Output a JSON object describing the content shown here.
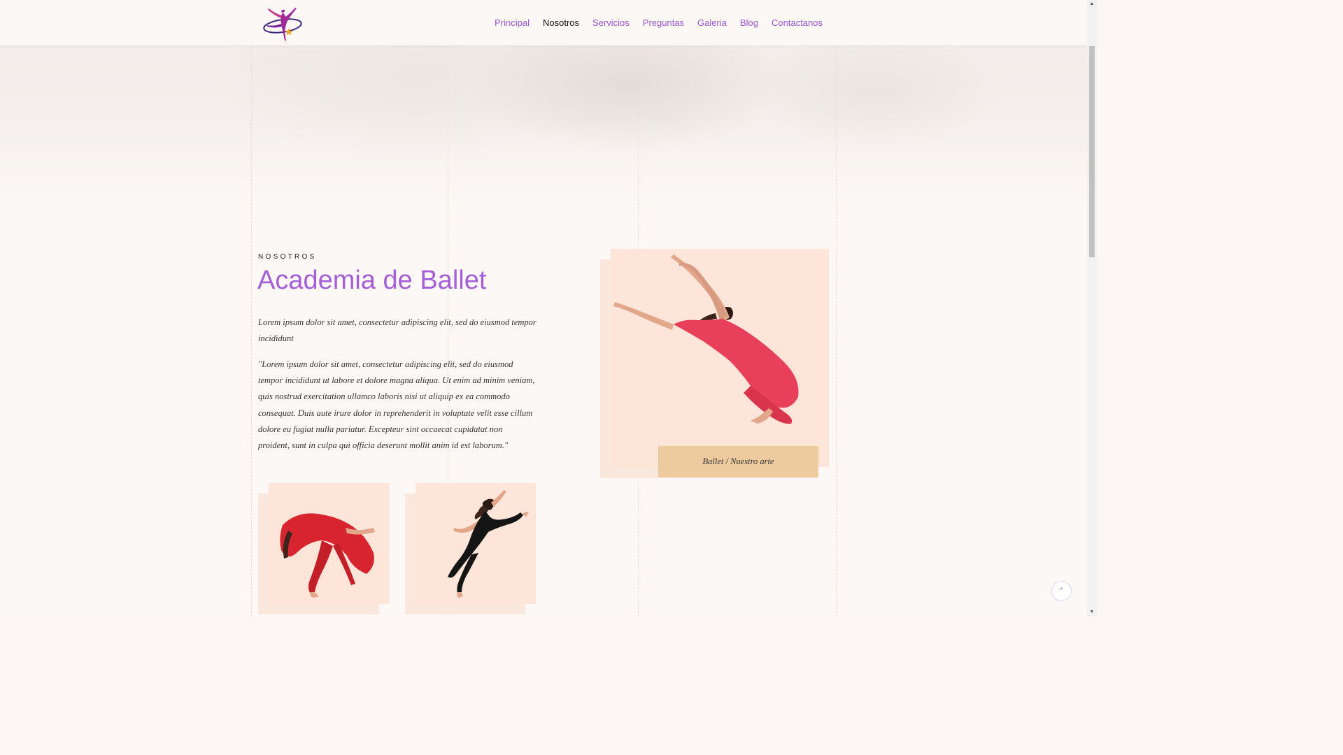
{
  "header": {
    "logo_icon": "ballerina-logo-icon",
    "nav": [
      {
        "label": "Principal",
        "active": false
      },
      {
        "label": "Nosotros",
        "active": true
      },
      {
        "label": "Servicios",
        "active": false
      },
      {
        "label": "Preguntas",
        "active": false
      },
      {
        "label": "Galeria",
        "active": false
      },
      {
        "label": "Blog",
        "active": false
      },
      {
        "label": "Contactanos",
        "active": false
      }
    ]
  },
  "about": {
    "eyebrow": "NOSOTROS",
    "title": "Academia de Ballet",
    "intro": "Lorem ipsum dolor sit amet, consectetur adipiscing elit, sed do eiusmod tempor incididunt",
    "quote": "\"Lorem ipsum dolor sit amet, consectetur adipiscing elit, sed do eiusmod tempor incididunt ut labore et dolore magna aliqua. Ut enim ad minim veniam, quis nostrud exercitation ullamco laboris nisi ut aliquip ex ea commodo consequat. Duis aute irure dolor in reprehenderit in voluptate velit esse cillum dolore eu fugiat nulla pariatur. Excepteur sint occaecat cupidatat non proident, sunt in culpa qui officia deserunt mollit anim id est laborum.\"",
    "featured_caption": "Ballet / Nuestro arte"
  },
  "colors": {
    "accent": "#a45ed8",
    "card_bg": "#fde6d9",
    "caption_bg": "#edcb9f"
  },
  "icons": {
    "to_top": "chevron-up-icon"
  }
}
